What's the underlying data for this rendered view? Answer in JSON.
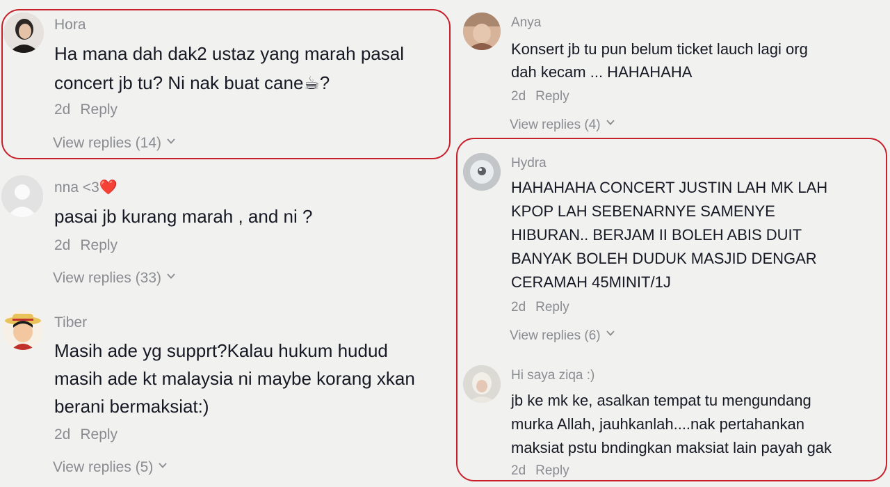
{
  "left_column": [
    {
      "username": "Hora",
      "text": "Ha mana dah dak2 ustaz yang marah pasal\nconcert jb tu? Ni nak buat cane☕?",
      "time": "2d",
      "reply_label": "Reply",
      "view_replies": "View replies (14)"
    },
    {
      "username": "nna <3",
      "username_emoji": "❤️",
      "text": "pasai jb kurang marah , and ni ?",
      "time": "2d",
      "reply_label": "Reply",
      "view_replies": "View replies (33)"
    },
    {
      "username": "Tiber",
      "text": "Masih ade yg supprt?Kalau hukum hudud\nmasih ade kt malaysia ni maybe korang xkan\nberani bermaksiat:)",
      "time": "2d",
      "reply_label": "Reply",
      "view_replies": "View replies (5)"
    }
  ],
  "right_column": [
    {
      "username": "Anya",
      "text": "Konsert jb tu pun belum ticket lauch lagi org\ndah kecam ... HAHAHAHA",
      "time": "2d",
      "reply_label": "Reply",
      "view_replies": "View replies (4)"
    },
    {
      "username": "Hydra",
      "text": "HAHAHAHA CONCERT JUSTIN LAH MK LAH\nKPOP LAH SEBENARNYE SAMENYE\nHIBURAN.. BERJAM II BOLEH ABIS DUIT\nBANYAK BOLEH DUDUK MASJID DENGAR\nCERAMAH 45MINIT/1J",
      "time": "2d",
      "reply_label": "Reply",
      "view_replies": "View replies (6)"
    },
    {
      "username": "Hi saya ziqa :)",
      "text": "jb ke mk ke, asalkan tempat tu mengundang\nmurka Allah, jauhkanlah....nak pertahankan\nmaksiat pstu bndingkan maksiat lain payah gak",
      "time": "2d",
      "reply_label": "Reply"
    }
  ],
  "colors": {
    "highlight": "#c8202a",
    "meta": "#8a8b91",
    "text": "#161823",
    "background": "#f1f1f0"
  }
}
